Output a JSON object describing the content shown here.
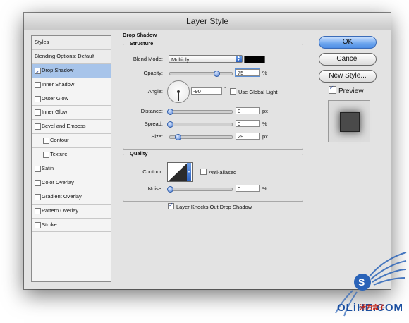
{
  "window": {
    "title": "Layer Style"
  },
  "styles_list": {
    "header": "Styles",
    "blending": "Blending Options: Default",
    "items": [
      {
        "label": "Drop Shadow",
        "checked": true,
        "selected": true,
        "sub": false
      },
      {
        "label": "Inner Shadow",
        "checked": false,
        "selected": false,
        "sub": false
      },
      {
        "label": "Outer Glow",
        "checked": false,
        "selected": false,
        "sub": false
      },
      {
        "label": "Inner Glow",
        "checked": false,
        "selected": false,
        "sub": false
      },
      {
        "label": "Bevel and Emboss",
        "checked": false,
        "selected": false,
        "sub": false
      },
      {
        "label": "Contour",
        "checked": false,
        "selected": false,
        "sub": true
      },
      {
        "label": "Texture",
        "checked": false,
        "selected": false,
        "sub": true
      },
      {
        "label": "Satin",
        "checked": false,
        "selected": false,
        "sub": false
      },
      {
        "label": "Color Overlay",
        "checked": false,
        "selected": false,
        "sub": false
      },
      {
        "label": "Gradient Overlay",
        "checked": false,
        "selected": false,
        "sub": false
      },
      {
        "label": "Pattern Overlay",
        "checked": false,
        "selected": false,
        "sub": false
      },
      {
        "label": "Stroke",
        "checked": false,
        "selected": false,
        "sub": false
      }
    ]
  },
  "drop_shadow": {
    "title": "Drop Shadow",
    "structure": {
      "title": "Structure",
      "blend_mode_label": "Blend Mode:",
      "blend_mode_value": "Multiply",
      "shadow_color": "#000000",
      "opacity_label": "Opacity:",
      "opacity_value": "75",
      "opacity_unit": "%",
      "opacity_level": 0.75,
      "angle_label": "Angle:",
      "angle_value": "-90",
      "angle_unit": "°",
      "use_global_light_label": "Use Global Light",
      "use_global_light_checked": false,
      "distance_label": "Distance:",
      "distance_value": "0",
      "distance_unit": "px",
      "distance_level": 0,
      "spread_label": "Spread:",
      "spread_value": "0",
      "spread_unit": "%",
      "spread_level": 0,
      "size_label": "Size:",
      "size_value": "29",
      "size_unit": "px",
      "size_level": 0.12
    },
    "quality": {
      "title": "Quality",
      "contour_label": "Contour:",
      "anti_aliased_label": "Anti-aliased",
      "anti_aliased_checked": false,
      "noise_label": "Noise:",
      "noise_value": "0",
      "noise_unit": "%",
      "noise_level": 0
    },
    "knocks_out_label": "Layer Knocks Out Drop Shadow",
    "knocks_out_checked": true
  },
  "buttons": {
    "ok": "OK",
    "cancel": "Cancel",
    "new_style": "New Style...",
    "preview_label": "Preview",
    "preview_checked": true
  },
  "watermark": {
    "text": "OLiHE.COM",
    "sub": "活力盒子"
  },
  "colors": {
    "selection": "#a7c4ea",
    "accent": "#4e8de4"
  }
}
